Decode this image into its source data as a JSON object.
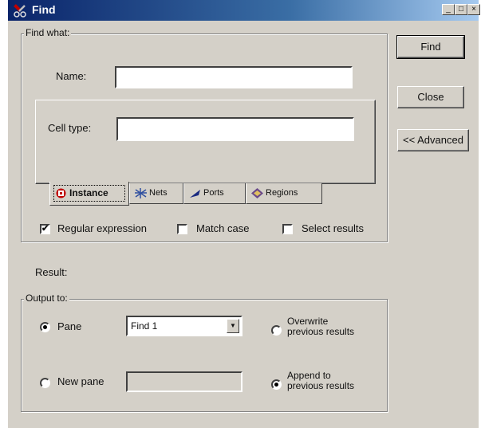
{
  "window": {
    "title": "Find",
    "controls": [
      "_",
      "□",
      "×"
    ]
  },
  "find_what": {
    "legend": "Find what:",
    "name_label": "Name:",
    "name_value": "",
    "celltype_label": "Cell type:",
    "celltype_value": ""
  },
  "tabs": [
    {
      "label": "Instance",
      "icon": "instance-icon",
      "active": true
    },
    {
      "label": "Nets",
      "icon": "nets-icon",
      "active": false
    },
    {
      "label": "Ports",
      "icon": "ports-icon",
      "active": false
    },
    {
      "label": "Regions",
      "icon": "regions-icon",
      "active": false
    }
  ],
  "options": {
    "regex": {
      "label": "Regular expression",
      "checked": true,
      "mark": "✔"
    },
    "match_case": {
      "label": "Match case",
      "checked": false
    },
    "select_results": {
      "label": "Select results",
      "checked": false
    }
  },
  "result_label": "Result:",
  "output": {
    "legend": "Output to:",
    "pane_label": "Pane",
    "pane_selected": true,
    "pane_value": "Find 1",
    "new_pane_label": "New pane",
    "new_pane_selected": false,
    "new_pane_value": "",
    "overwrite_line1": "Overwrite",
    "overwrite_line2": "previous results",
    "overwrite_selected": false,
    "append_line1": "Append to",
    "append_line2": "previous results",
    "append_selected": true
  },
  "buttons": {
    "find": "Find",
    "close": "Close",
    "advanced": "<< Advanced"
  },
  "colors": {
    "face": "#d4d0c8",
    "title_start": "#0a246a",
    "title_end": "#a6caf0"
  }
}
